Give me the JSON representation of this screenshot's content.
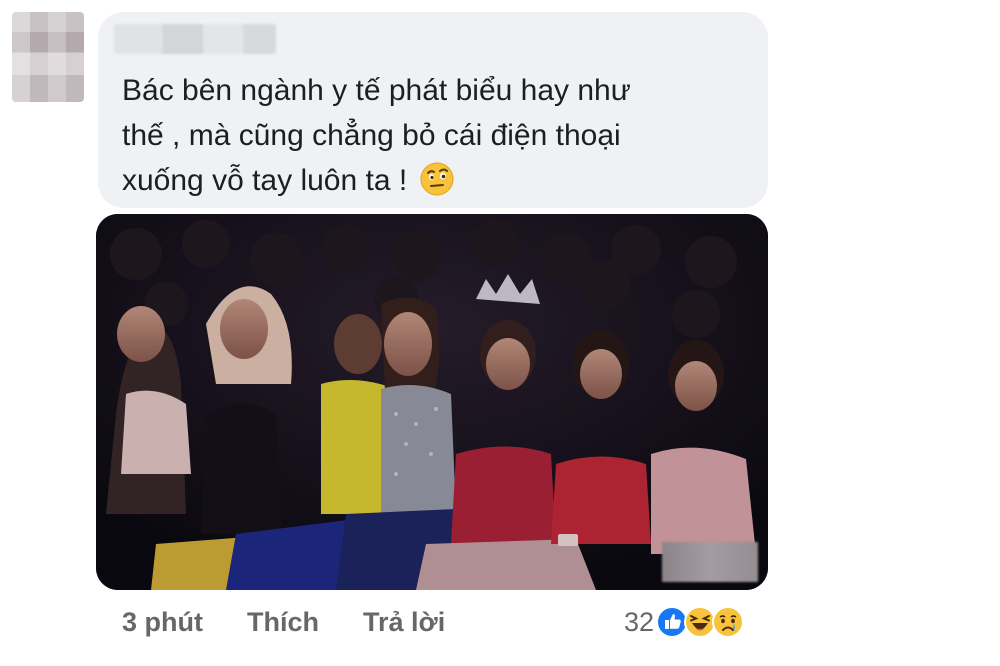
{
  "comment": {
    "text_line1": "Bác bên ngành y tế phát biểu hay như",
    "text_line2": "thế , mà cũng chẳng bỏ cái điện thoại",
    "text_line3": "xuống vỗ tay luôn ta !",
    "emoji": "face-with-raised-eyebrow-icon"
  },
  "actions": {
    "time": "3 phút",
    "like": "Thích",
    "reply": "Trả lời"
  },
  "reactions": {
    "count": "32",
    "icons": [
      "like-icon",
      "haha-icon",
      "sad-icon"
    ]
  },
  "colors": {
    "bubble": "#f0f1f4",
    "text": "#1c1e21",
    "meta": "#65676b",
    "like_blue": "#1877f2"
  }
}
